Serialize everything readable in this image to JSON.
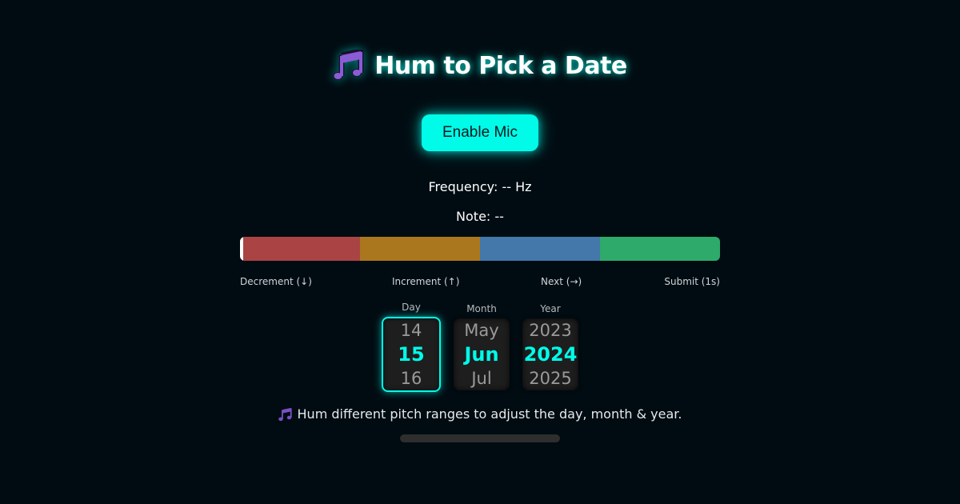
{
  "header": {
    "icon": "music-notes-icon",
    "title": "Hum to Pick a Date"
  },
  "mic_button": {
    "label": "Enable Mic"
  },
  "readouts": {
    "frequency": "Frequency: -- Hz",
    "note": "Note: --"
  },
  "pitch_bar": {
    "indicator_fraction": 0,
    "segments": [
      {
        "color": "#aa4444"
      },
      {
        "color": "#aa771e"
      },
      {
        "color": "#4477aa"
      },
      {
        "color": "#2eaa6a"
      }
    ]
  },
  "range_labels": [
    "Decrement (↓)",
    "Increment (↑)",
    "Next (→)",
    "Submit (1s)"
  ],
  "picker": {
    "active_column": "day",
    "columns": {
      "day": {
        "label": "Day",
        "prev": "14",
        "value": "15",
        "next": "16"
      },
      "month": {
        "label": "Month",
        "prev": "May",
        "value": "Jun",
        "next": "Jul"
      },
      "year": {
        "label": "Year",
        "prev": "2023",
        "value": "2024",
        "next": "2025"
      }
    }
  },
  "hint": {
    "icon": "music-notes-icon",
    "text": "Hum different pitch ranges to adjust the day, month & year."
  },
  "progress": {
    "fraction": 0
  },
  "colors": {
    "accent": "#00fbe9",
    "background": "#000c12",
    "icon_purple": "#7b4fc4"
  }
}
